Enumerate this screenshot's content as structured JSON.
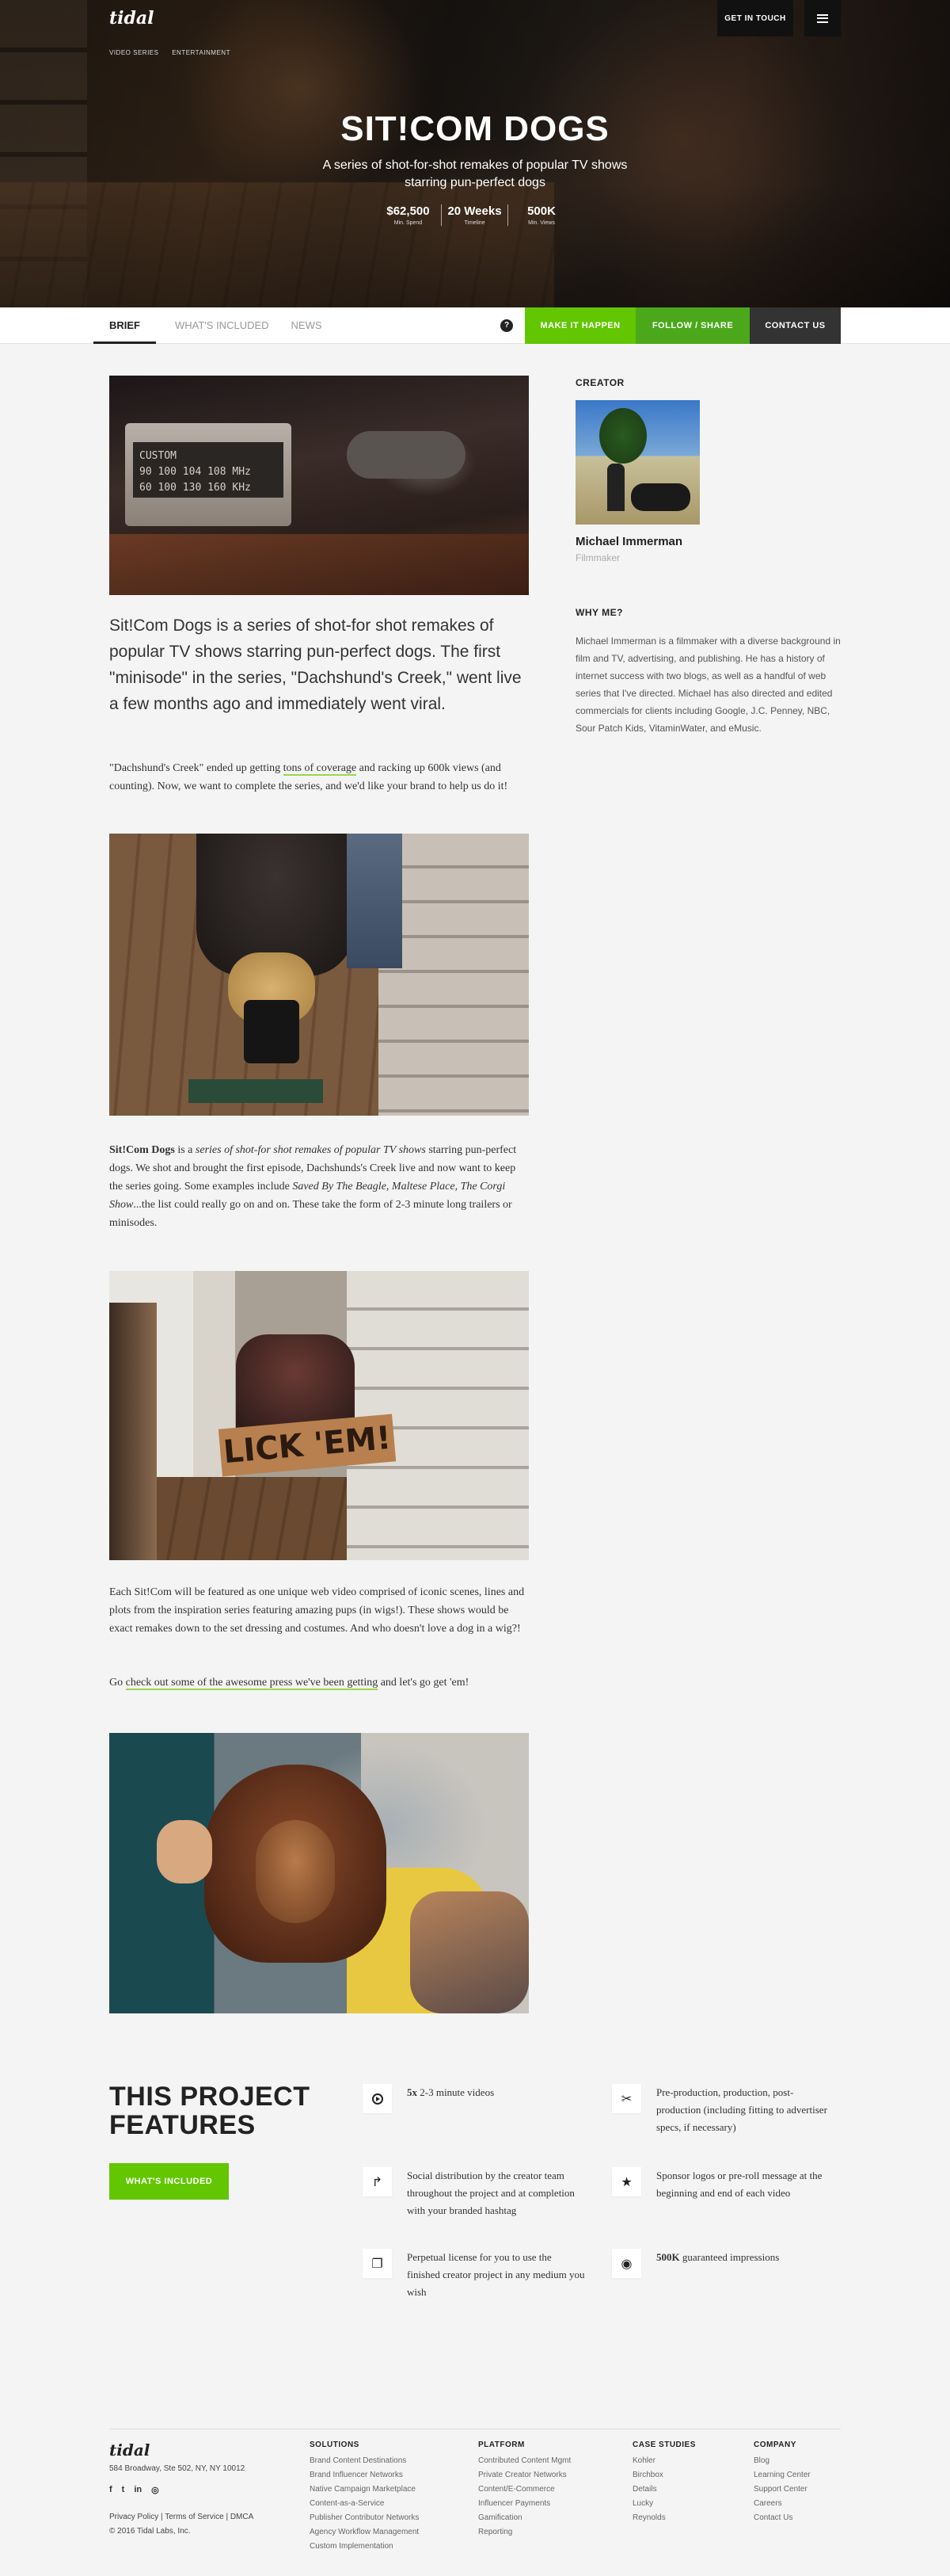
{
  "header": {
    "logo": "tidal",
    "breadcrumbs": [
      "VIDEO SERIES",
      "ENTERTAINMENT"
    ],
    "get_in_touch": "GET IN TOUCH",
    "menu_icon": "hamburger-icon"
  },
  "hero": {
    "title": "SIT!COM DOGS",
    "subtitle": "A series of shot-for-shot remakes of popular TV shows starring pun-perfect dogs",
    "stats": [
      {
        "value": "$62,500",
        "label": "Min. Spend"
      },
      {
        "value": "20 Weeks",
        "label": "Timeline"
      },
      {
        "value": "500K",
        "label": "Min. Views"
      }
    ]
  },
  "tabs": {
    "items": [
      "BRIEF",
      "WHAT'S INCLUDED",
      "NEWS"
    ],
    "active": "BRIEF",
    "help": "?",
    "make_it_happen": "MAKE IT HAPPEN",
    "follow_share": "FOLLOW / SHARE",
    "contact_us": "CONTACT US"
  },
  "photo1": {
    "dial_line1": "CUSTOM",
    "dial_line2": "90 100 104 108 MHz",
    "dial_line3": "60 100 130 160 KHz"
  },
  "photo3": {
    "sign": "LICK 'EM!"
  },
  "content": {
    "lead": "Sit!Com Dogs is a series of shot-for shot remakes of popular TV shows starring pun-perfect dogs. The first \"minisode\" in the series, \"Dachshund's Creek,\" went live a few months ago and immediately went viral.",
    "p1_a": "\"Dachshund's Creek\" ended up getting ",
    "p1_link": "tons of coverage",
    "p1_b": " and racking up 600k views (and counting). Now, we want to complete the series, and we'd like your brand to help us do it!",
    "p2_bold": "Sit!Com Dogs",
    "p2_a": " is a ",
    "p2_italic": "series of shot-for shot remakes of popular TV shows",
    "p2_b": " starring pun-perfect dogs. We shot and brought the first episode, Dachshunds's Creek live and now want to keep the series going. Some examples include ",
    "p2_ex": "Saved By The Beagle, Maltese Place, The Corgi Show",
    "p2_c": "...the list could really go on and on. These take the form of 2-3 minute long trailers or minisodes.",
    "p3": "Each Sit!Com will be featured as one unique web video comprised of iconic scenes, lines and plots from the inspiration series featuring amazing pups (in wigs!). These shows would be exact remakes down to the set dressing and costumes. And who doesn't love a dog in a wig?!",
    "p4_a": "Go ",
    "p4_link": "check out some of the awesome press we've been getting",
    "p4_b": " and let's go get 'em!"
  },
  "sidebar": {
    "creator_heading": "CREATOR",
    "creator_name": "Michael Immerman",
    "creator_role": "Filmmaker",
    "why_heading": "WHY ME?",
    "why_text": "Michael Immerman is a filmmaker with a diverse background in film and TV, advertising, and publishing. He has a history of internet success with two blogs, as well as a handful of web series that I've directed. Michael has also directed and edited commercials for clients including Google, J.C. Penney, NBC, Sour Patch Kids, VitaminWater, and eMusic."
  },
  "features": {
    "title_line1": "THIS PROJECT",
    "title_line2": "FEATURES",
    "button": "WHAT'S INCLUDED",
    "items": [
      {
        "icon": "play-icon",
        "bold": "5x",
        "text": " 2-3 minute videos"
      },
      {
        "icon": "scissors-icon",
        "bold": "",
        "text": "Pre-production, production, post-production (including fitting to advertiser specs, if necessary)"
      },
      {
        "icon": "share-arrow-icon",
        "bold": "",
        "text": "Social distribution by the creator team throughout the project and at completion with your branded hashtag"
      },
      {
        "icon": "star-icon",
        "bold": "",
        "text": "Sponsor logos or pre-roll message at the beginning and end of each video"
      },
      {
        "icon": "copy-icon",
        "bold": "",
        "text": "Perpetual license for you to use the finished creator project in any medium you wish"
      },
      {
        "icon": "eye-icon",
        "bold": "500K",
        "text": " guaranteed impressions"
      }
    ]
  },
  "footer": {
    "logo": "tidal",
    "address": "584 Broadway, Ste 502, NY, NY 10012",
    "social": [
      "f",
      "t",
      "in",
      "◎"
    ],
    "legal_line1": "Privacy Policy | Terms of Service | DMCA",
    "legal_line2": "© 2016 Tidal Labs, Inc.",
    "columns": [
      {
        "heading": "SOLUTIONS",
        "items": [
          "Brand Content Destinations",
          "Brand Influencer Networks",
          "Native Campaign Marketplace",
          "Content-as-a-Service",
          "Publisher Contributor Networks",
          "Agency Workflow Management",
          "Custom Implementation"
        ]
      },
      {
        "heading": "PLATFORM",
        "items": [
          "Contributed Content Mgmt",
          "Private Creator Networks",
          "Content/E-Commerce",
          "Influencer Payments",
          "Gamification",
          "Reporting"
        ]
      },
      {
        "heading": "CASE STUDIES",
        "items": [
          "Kohler",
          "Birchbox",
          "Details",
          "Lucky",
          "Reynolds"
        ]
      },
      {
        "heading": "COMPANY",
        "items": [
          "Blog",
          "Learning Center",
          "Support Center",
          "Careers",
          "Contact Us"
        ]
      }
    ]
  }
}
